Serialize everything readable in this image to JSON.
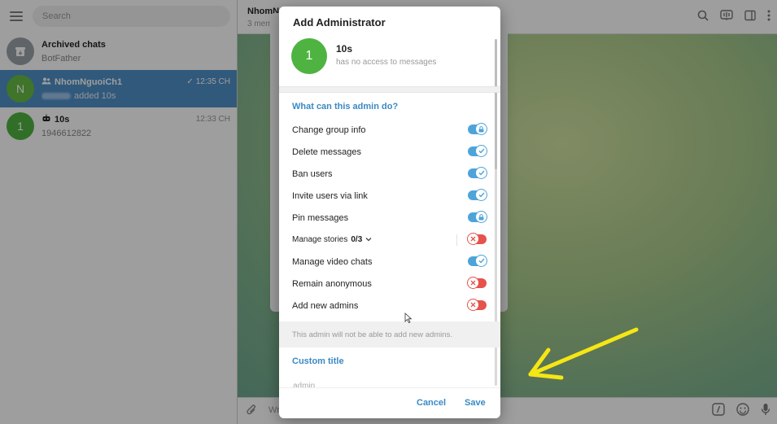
{
  "left": {
    "search_placeholder": "Search",
    "chats": [
      {
        "title": "Archived chats",
        "subtitle": "BotFather",
        "avatar": ""
      },
      {
        "title": "NhomNguoiCh1",
        "subtitle": "added 10s",
        "time": "12:35 CH",
        "avatar": "N"
      },
      {
        "title": "10s",
        "subtitle": "1946612822",
        "time": "12:33 CH",
        "avatar": "1"
      }
    ]
  },
  "chat_header": {
    "title": "NhomNg",
    "subtitle": "3 mem"
  },
  "composer": {
    "placeholder": "Wr"
  },
  "dialog": {
    "title": "Add Administrator",
    "user": {
      "avatar": "1",
      "name": "10s",
      "status": "has no access to messages"
    },
    "section_title": "What can this admin do?",
    "permissions": [
      {
        "label": "Change group info",
        "state": "on",
        "locked": true
      },
      {
        "label": "Delete messages",
        "state": "on",
        "locked": false
      },
      {
        "label": "Ban users",
        "state": "on",
        "locked": false
      },
      {
        "label": "Invite users via link",
        "state": "on",
        "locked": false
      },
      {
        "label": "Pin messages",
        "state": "on",
        "locked": true
      },
      {
        "label": "Manage stories",
        "count": "0/3",
        "state": "off",
        "locked": false
      },
      {
        "label": "Manage video chats",
        "state": "on",
        "locked": false
      },
      {
        "label": "Remain anonymous",
        "state": "off",
        "locked": false
      },
      {
        "label": "Add new admins",
        "state": "off",
        "locked": false
      }
    ],
    "hint": "This admin will not be able to add new admins.",
    "custom_title_label": "Custom title",
    "custom_title_placeholder": "admin",
    "cancel": "Cancel",
    "save": "Save"
  },
  "colors": {
    "accent": "#3a8ac4",
    "toggle_on": "#4ea4d9",
    "toggle_off": "#e5534b",
    "arrow": "#f5e614"
  }
}
